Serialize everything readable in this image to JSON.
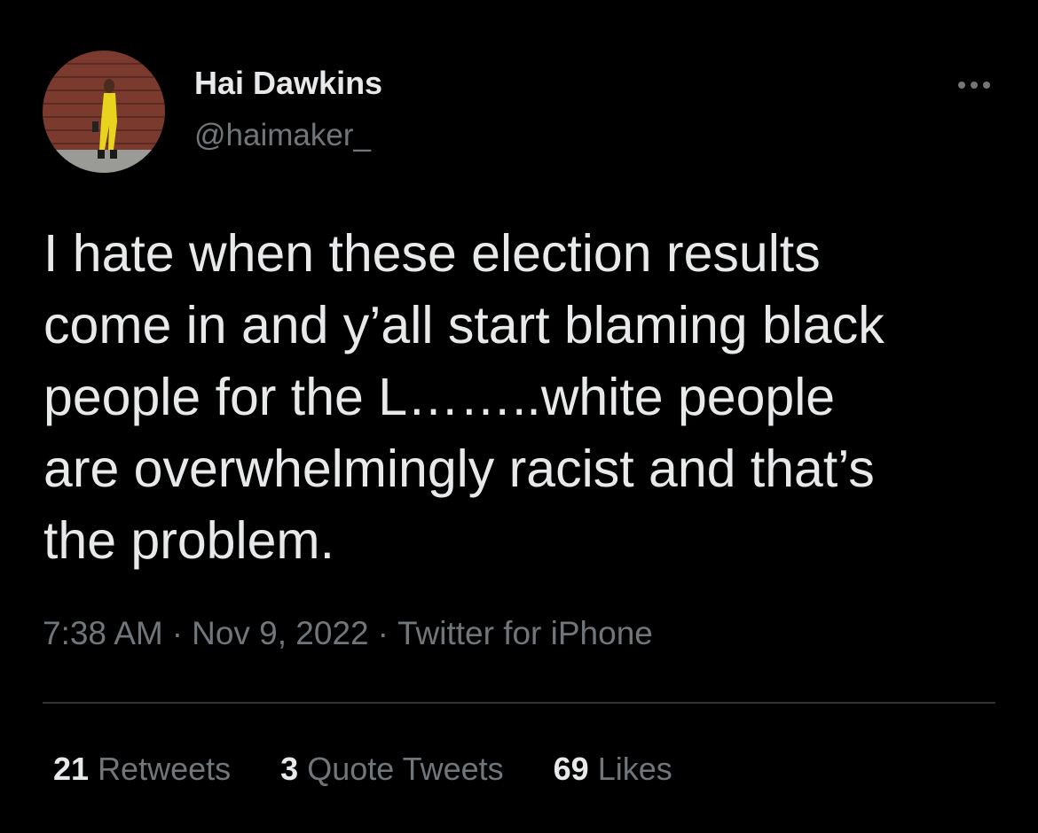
{
  "author": {
    "name": "Hai Dawkins",
    "handle": "@haimaker_",
    "avatar_icon": "profile-photo"
  },
  "more_icon": "ellipsis-icon",
  "tweet": {
    "text_lines": [
      "I hate when these election results",
      "come in and y’all start blaming black",
      "people for the L……..white people",
      "are overwhelmingly racist and that’s",
      "the problem."
    ]
  },
  "meta": {
    "time": "7:38 AM",
    "date": "Nov 9, 2022",
    "source": "Twitter for iPhone",
    "separator": "·"
  },
  "stats": {
    "retweets": {
      "count": "21",
      "label": "Retweets"
    },
    "quote_tweets": {
      "count": "3",
      "label": "Quote Tweets"
    },
    "likes": {
      "count": "69",
      "label": "Likes"
    }
  },
  "colors": {
    "background": "#000000",
    "primary_text": "#e7e9ea",
    "secondary_text": "#71767b",
    "divider": "#2f3336"
  }
}
